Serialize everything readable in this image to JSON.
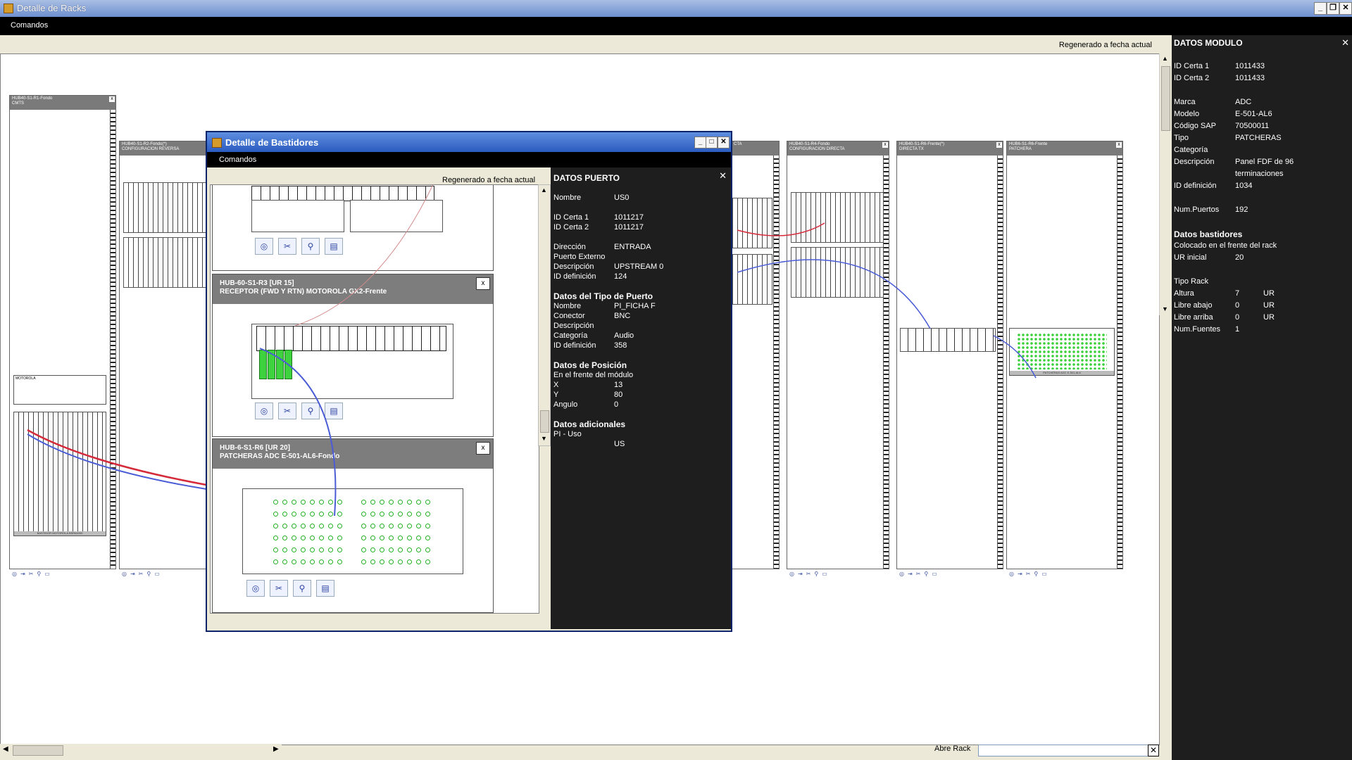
{
  "window": {
    "title": "Detalle de Racks"
  },
  "menu": {
    "comandos": "Comandos"
  },
  "main": {
    "regen": "Regenerado a fecha actual",
    "abre_rack_label": "Abre Rack",
    "abre_rack_value": ""
  },
  "racks": [
    {
      "header": "HUB40-S1-R1-Fondo\nCMTS"
    },
    {
      "header": "HUB40-S1-R2-Fondo(*)\nCONFIGURACION REVERSA"
    },
    {
      "header": "CTA"
    },
    {
      "header": "HUB40-S1-R4-Fondo\nCONFIGURACION DIRECTA"
    },
    {
      "header": "HUB40-S1-R6-Frente(*)\nDIRECTA TX"
    },
    {
      "header": "HUB6-S1-R6-Frente\nPATCHERA"
    }
  ],
  "rack_panel_labels": {
    "motorola": "MOTOROLA",
    "bastidor_motorola": "BASTIDOR MOTOROLA BSR64000",
    "patcheras": "PATCHERAS ADC E-501-AL6"
  },
  "dialog": {
    "title": "Detalle de Bastidores",
    "menu": "Comandos",
    "regen": "Regenerado a fecha actual",
    "cards": [
      {
        "title1": "HUB-60-S1-R3 [UR 15]",
        "title2": "RECEPTOR (FWD Y RTN) MOTOROLA GX2-Frente"
      },
      {
        "title1": "HUB-6-S1-R6 [UR 20]",
        "title2": "PATCHERAS ADC E-501-AL6-Fondo"
      }
    ]
  },
  "puerto": {
    "title": "DATOS PUERTO",
    "nombre_l": "Nombre",
    "nombre_v": "US0",
    "idc1_l": "ID Certa 1",
    "idc1_v": "1011217",
    "idc2_l": "ID Certa 2",
    "idc2_v": "1011217",
    "dir_l": "Dirección",
    "dir_v": "ENTRADA",
    "ext_l": "Puerto Externo",
    "desc_l": "Descripción",
    "desc_v": "UPSTREAM 0",
    "iddef_l": "ID definición",
    "iddef_v": "124",
    "tipo_h": "Datos del Tipo de Puerto",
    "t_nombre_l": "Nombre",
    "t_nombre_v": "PI_FICHA F",
    "t_con_l": "Conector",
    "t_con_v": "BNC",
    "t_desc_l": "Descripción",
    "t_cat_l": "Categoría",
    "t_cat_v": "Audio",
    "t_iddef_l": "ID definición",
    "t_iddef_v": "358",
    "pos_h": "Datos de Posición",
    "pos_sub": "En el frente del módulo",
    "x_l": "X",
    "x_v": "13",
    "y_l": "Y",
    "y_v": "80",
    "ang_l": "Angulo",
    "ang_v": "0",
    "adic_h": "Datos adicionales",
    "pi_l": "PI - Uso",
    "pi_v": "US"
  },
  "modulo": {
    "title": "DATOS MODULO",
    "idc1_l": "ID Certa 1",
    "idc1_v": "1011433",
    "idc2_l": "ID Certa 2",
    "idc2_v": "1011433",
    "marca_l": "Marca",
    "marca_v": "ADC",
    "modelo_l": "Modelo",
    "modelo_v": "E-501-AL6",
    "sap_l": "Código SAP",
    "sap_v": "70500011",
    "tipo_l": "Tipo",
    "tipo_v": "PATCHERAS",
    "cat_l": "Categoría",
    "desc_l": "Descripción",
    "desc_v1": "Panel FDF de 96",
    "desc_v2": "terminaciones",
    "iddef_l": "ID definición",
    "iddef_v": "1034",
    "np_l": "Num.Puertos",
    "np_v": "192",
    "bast_h": "Datos bastidores",
    "bast_sub": "Colocado en el frente del rack",
    "urini_l": "UR inicial",
    "urini_v": "20",
    "tiporack_l": "Tipo Rack",
    "alt_l": "Altura",
    "alt_v": "7",
    "alt_u": "UR",
    "la_l": "Libre abajo",
    "la_v": "0",
    "la_u": "UR",
    "lar_l": "Libre arriba",
    "lar_v": "0",
    "lar_u": "UR",
    "nf_l": "Num.Fuentes",
    "nf_v": "1"
  },
  "colors": {
    "menu_bg": "#000000",
    "panel_bg": "#1e1e1e",
    "title_blue": "#2a5bc0",
    "cable_red": "#d42a3a",
    "cable_blue": "#4a5cd6",
    "port_green": "#3bd13b"
  }
}
